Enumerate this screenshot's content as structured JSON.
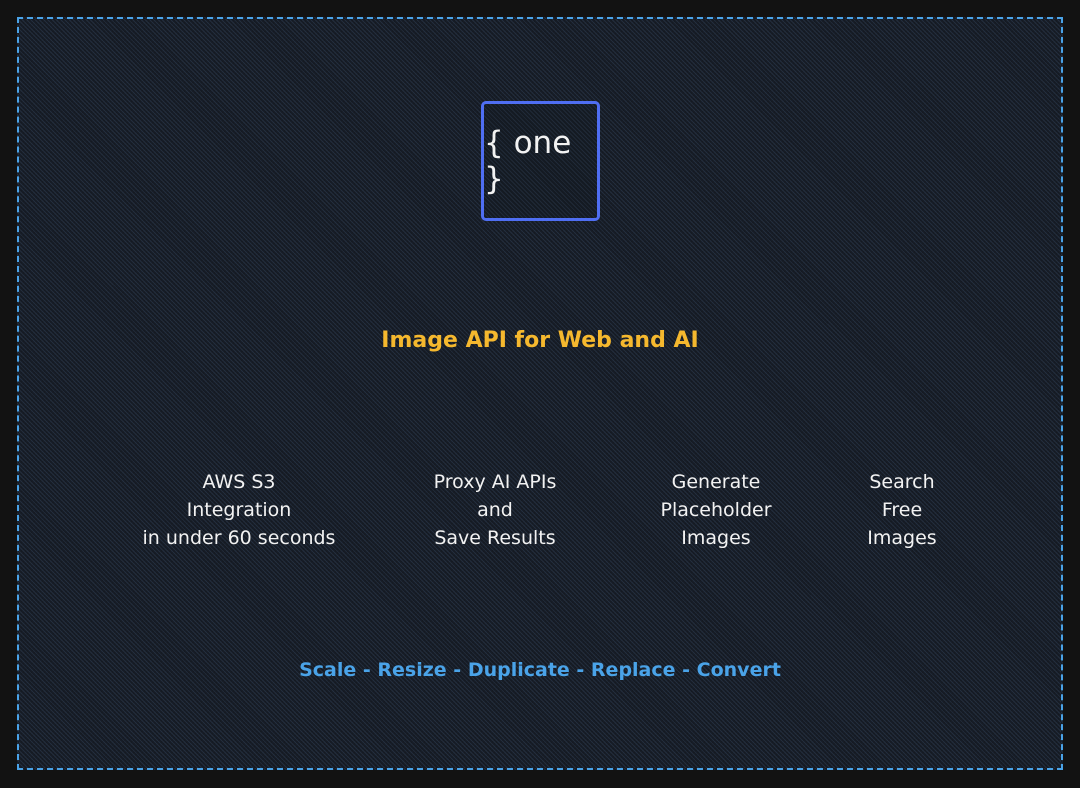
{
  "logo": {
    "text": "{ one }"
  },
  "tagline": "Image API for Web and AI",
  "features": [
    {
      "lines": [
        "AWS S3",
        "Integration",
        "in under 60 seconds"
      ]
    },
    {
      "lines": [
        "Proxy AI APIs",
        "and",
        "Save Results"
      ]
    },
    {
      "lines": [
        "Generate",
        "Placeholder",
        "Images"
      ]
    },
    {
      "lines": [
        "Search",
        "Free",
        "Images"
      ]
    }
  ],
  "actions": {
    "items": [
      "Scale",
      "Resize",
      "Duplicate",
      "Replace",
      "Convert"
    ],
    "separator": " - "
  },
  "colors": {
    "accent_blue": "#4aa3e8",
    "logo_border": "#4f6ef2",
    "tagline": "#f5b82e",
    "text": "#f2f2f2",
    "outer_bg": "#121212"
  }
}
